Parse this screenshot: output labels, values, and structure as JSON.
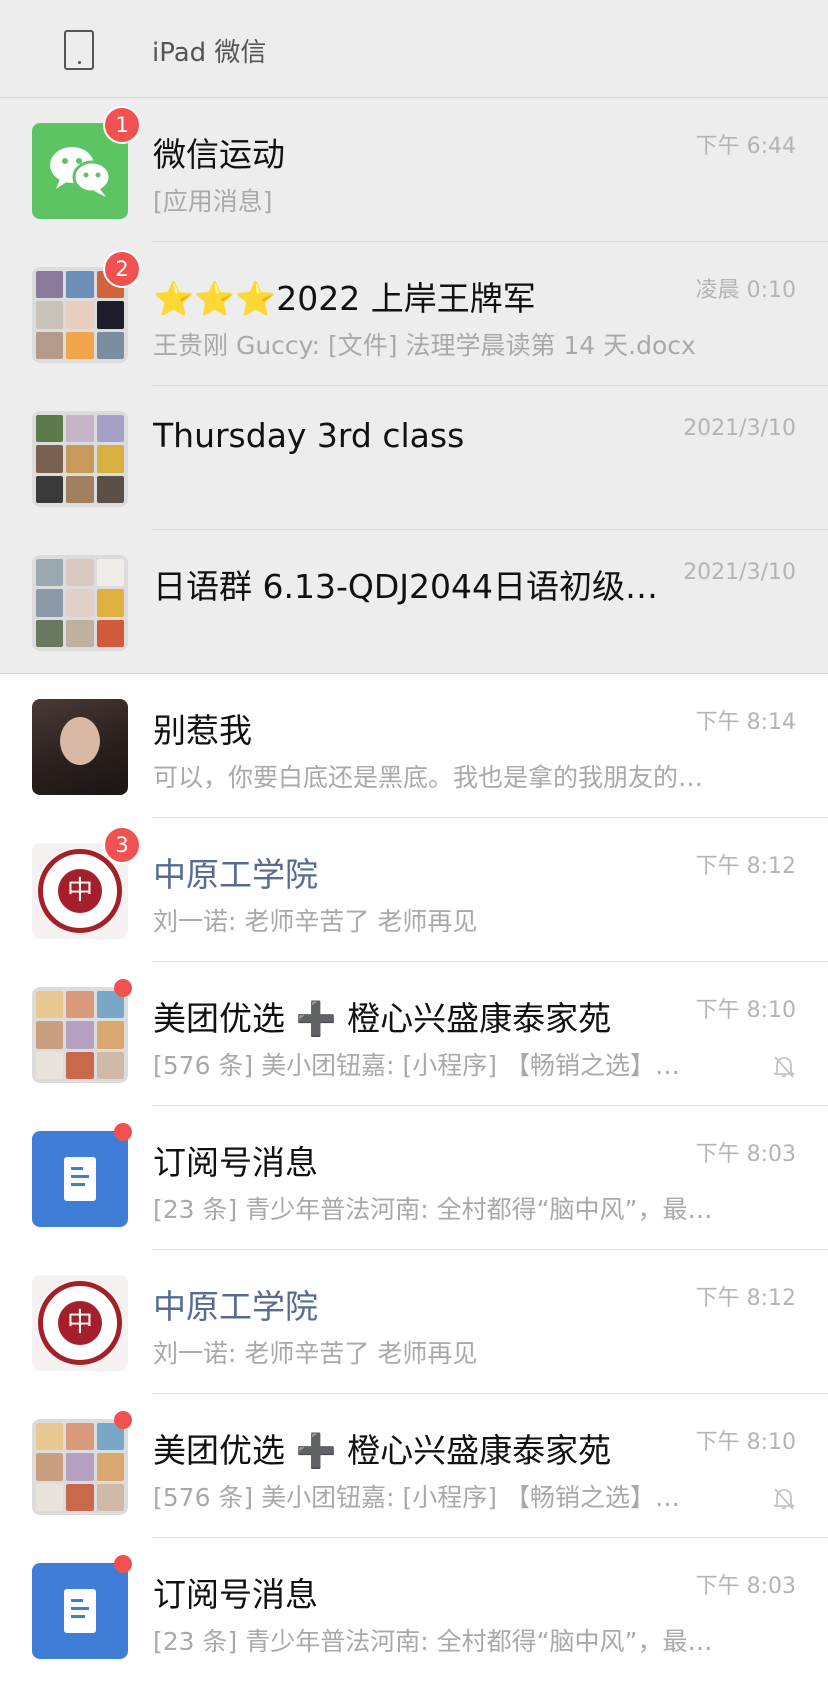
{
  "header": {
    "title": "iPad 微信",
    "device_icon": "tablet-icon"
  },
  "colors": {
    "pinned_bg": "#ededed",
    "badge": "#f05252",
    "link_name": "#566b94",
    "wechat_green": "#5dc464",
    "subscription_blue": "#3f7ed6",
    "seal_red": "#a3202a"
  },
  "chats": [
    {
      "name": "微信运动",
      "preview": "[应用消息]",
      "time": "下午 6:44",
      "badge": "1",
      "avatar": "wechat-sport-icon"
    },
    {
      "name": "⭐⭐⭐2022 上岸王牌军",
      "preview": "王贵刚 Guccy: [文件] 法理学晨读第 14 天.docx",
      "time": "凌晨 0:10",
      "badge": "2",
      "avatar": "group-grid"
    },
    {
      "name": "Thursday 3rd class",
      "preview": "",
      "time": "2021/3/10",
      "avatar": "group-grid"
    },
    {
      "name": "日语群 6.13-QDJ2044日语初级…",
      "preview": "",
      "time": "2021/3/10",
      "avatar": "group-grid"
    },
    {
      "name": "别惹我",
      "preview": "可以，你要白底还是黑底。我也是拿的我朋友的…",
      "time": "下午 8:14",
      "avatar": "photo"
    },
    {
      "name": "中原工学院",
      "preview": "刘一诺: 老师辛苦了 老师再见",
      "time": "下午 8:12",
      "badge": "3",
      "avatar": "university-seal"
    },
    {
      "name": "美团优选 ➕ 橙心兴盛康泰家苑",
      "preview": "[576 条] 美小团钮嘉: [小程序] 【畅销之选】…",
      "time": "下午 8:10",
      "avatar": "group-grid",
      "muted": true
    },
    {
      "name": "订阅号消息",
      "preview": "[23 条] 青少年普法河南: 全村都得“脑中风”，最…",
      "time": "下午 8:03",
      "avatar": "subscription-icon"
    },
    {
      "name": "中原工学院",
      "preview": "刘一诺: 老师辛苦了 老师再见",
      "time": "下午 8:12",
      "avatar": "university-seal"
    },
    {
      "name": "美团优选 ➕ 橙心兴盛康泰家苑",
      "preview": "[576 条] 美小团钮嘉: [小程序] 【畅销之选】…",
      "time": "下午 8:10",
      "avatar": "group-grid",
      "muted": true
    },
    {
      "name": "订阅号消息",
      "preview": "[23 条] 青少年普法河南: 全村都得“脑中风”，最…",
      "time": "下午 8:03",
      "avatar": "subscription-icon"
    }
  ]
}
